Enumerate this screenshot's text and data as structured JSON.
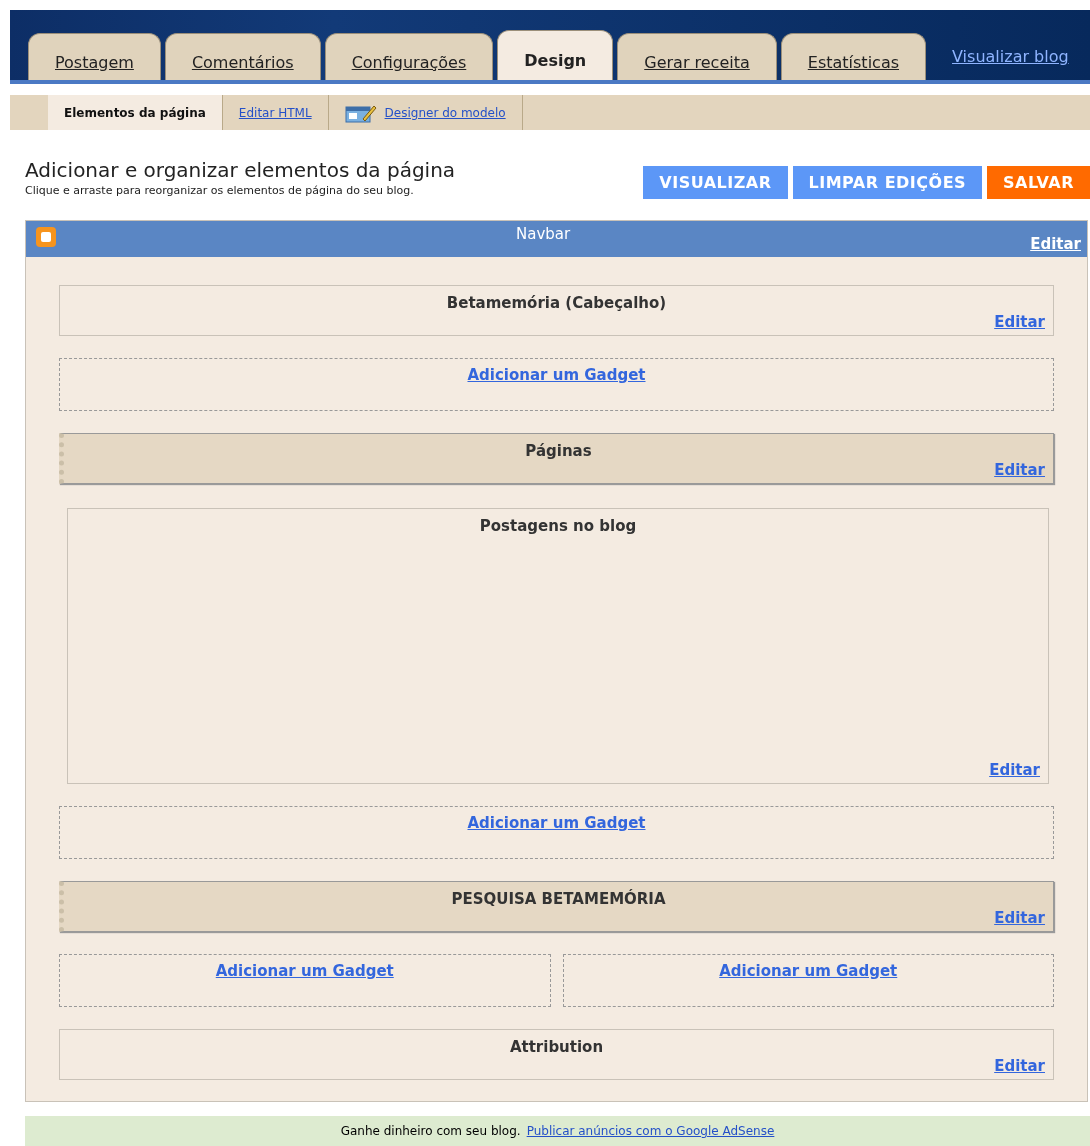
{
  "tabs": [
    {
      "label": "Postagem",
      "selected": false
    },
    {
      "label": "Comentários",
      "selected": false
    },
    {
      "label": "Configurações",
      "selected": false
    },
    {
      "label": "Design",
      "selected": true
    },
    {
      "label": "Gerar receita",
      "selected": false
    },
    {
      "label": "Estatísticas",
      "selected": false
    }
  ],
  "view_blog_link": "Visualizar blog",
  "subtabs": [
    {
      "label": "Elementos da página",
      "selected": true
    },
    {
      "label": "Editar HTML",
      "selected": false
    },
    {
      "label": "Designer do modelo",
      "selected": false,
      "icon": true
    }
  ],
  "heading": "Adicionar e organizar elementos da página",
  "subheading": "Clique e arraste para reorganizar os elementos de página do seu blog.",
  "buttons": [
    {
      "label": "VISUALIZAR",
      "kind": "blue"
    },
    {
      "label": "LIMPAR EDIÇÕES",
      "kind": "blue"
    },
    {
      "label": "SALVAR",
      "kind": "orange"
    }
  ],
  "navbar": {
    "title": "Navbar",
    "edit": "Editar"
  },
  "rows": [
    {
      "items": [
        {
          "kind": "widget",
          "title": "Betamemória (Cabeçalho)",
          "edit": "Editar"
        }
      ]
    },
    {
      "items": [
        {
          "kind": "add",
          "link": "Adicionar um Gadget"
        }
      ]
    },
    {
      "items": [
        {
          "kind": "fixed",
          "title": "Páginas",
          "edit": "Editar"
        }
      ]
    },
    {
      "items": [
        {
          "kind": "main",
          "title": "Postagens no blog",
          "edit": "Editar"
        }
      ]
    },
    {
      "items": [
        {
          "kind": "add",
          "link": "Adicionar um Gadget"
        }
      ]
    },
    {
      "items": [
        {
          "kind": "fixed",
          "title": "PESQUISA BETAMEMÓRIA",
          "edit": "Editar"
        }
      ]
    },
    {
      "items": [
        {
          "kind": "add",
          "link": "Adicionar um Gadget"
        },
        {
          "kind": "add",
          "link": "Adicionar um Gadget"
        }
      ]
    },
    {
      "items": [
        {
          "kind": "widget",
          "title": "Attribution",
          "edit": "Editar"
        }
      ]
    }
  ],
  "footer": {
    "text": "Ganhe dinheiro com seu blog.",
    "link": "Publicar anúncios com o Google AdSense"
  }
}
